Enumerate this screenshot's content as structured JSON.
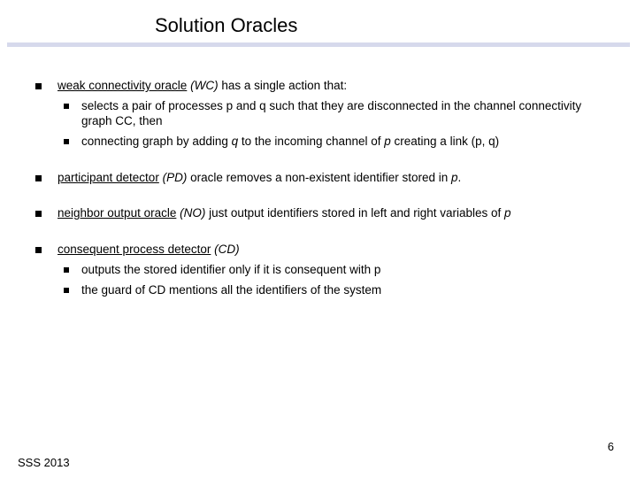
{
  "title": "Solution Oracles",
  "items": [
    {
      "lead_underlined": "weak connectivity oracle",
      "lead_rest": " (WC) has a single action that:",
      "lead_italic_abbrev": "(WC)",
      "subs": [
        "selects a pair of processes p and q such that they are disconnected in the channel connectivity graph CC, then",
        "connecting graph by adding q to the incoming channel of p creating a link (p, q)"
      ]
    },
    {
      "lead_underlined": "participant detector",
      "lead_rest": " (PD) oracle removes a non-existent identifier stored in p.",
      "subs": []
    },
    {
      "lead_underlined": "neighbor output oracle",
      "lead_rest": " (NO) just output identifiers stored in left and right variables of p",
      "subs": []
    },
    {
      "lead_underlined": "consequent process detector",
      "lead_rest": " (CD)",
      "subs": [
        "outputs the stored identifier only if it is consequent with p",
        "the guard of CD mentions all the identifiers of the system"
      ]
    }
  ],
  "page_number": "6",
  "footer": "SSS 2013"
}
